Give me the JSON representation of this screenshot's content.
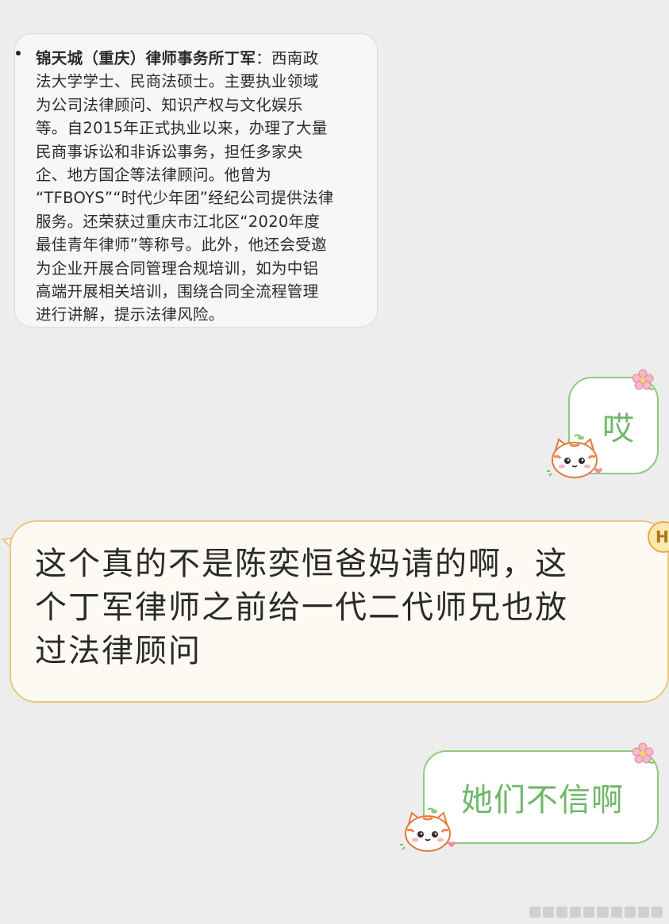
{
  "info_card": {
    "lines": [
      "锦天城（重庆）律师事务所丁军",
      "：西南政",
      "法大学学士、民商法硕士。主要执业领域",
      "为公司法律顾问、知识产权与文化娱乐",
      "等。自2015年正式执业以来，办理了大量",
      "民商事诉讼和非诉讼事务，担任多家央",
      "企、地方国企等法律顾问。他曾为",
      "“TFBOYS”“时代少年团”经纪公司提供法律",
      "服务。还荣获过重庆市江北区“2020年度",
      "最佳青年律师”等称号。此外，他还会受邀",
      "为企业开展合同管理合规培训，如为中铝",
      "高端开展相关培训，围绕合同全流程管理",
      "进行讲解，提示法律风险。"
    ]
  },
  "messages": {
    "sent_1": "哎",
    "received_1": {
      "lines": [
        "这个真的不是陈奕恒爸妈请的啊，这",
        "个丁军律师之前给一代二代师兄也放",
        "过法律顾问"
      ],
      "badge": "H"
    },
    "sent_2": "她们不信啊"
  },
  "colors": {
    "sent_border": "#8fcb7c",
    "sent_text": "#6fb86a",
    "received_border": "#e8c882",
    "received_bg": "#fdfaf3",
    "background": "#ededed"
  },
  "icons": {
    "sent_sticker": "cat-sticker-icon",
    "sent_decoration": "flower-icon",
    "received_avatar": "hello-badge-icon"
  }
}
